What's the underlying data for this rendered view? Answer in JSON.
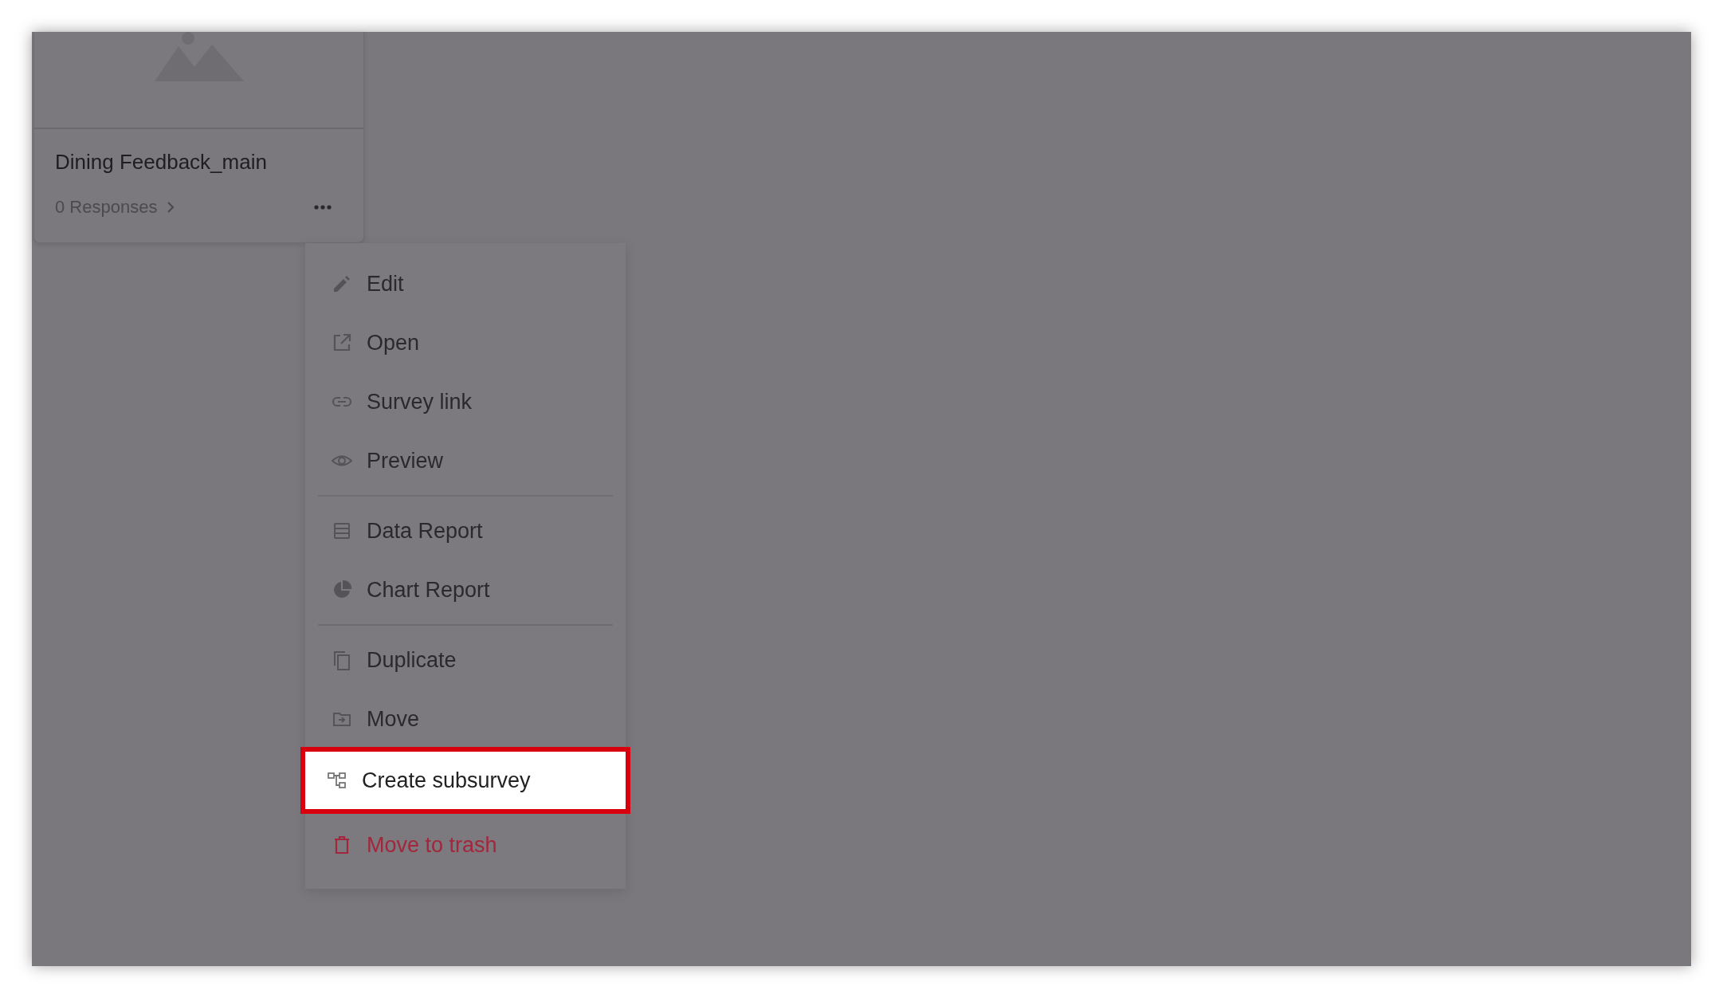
{
  "card": {
    "title": "Dining Feedback_main",
    "responses": "0 Responses"
  },
  "menu": {
    "groups": [
      [
        {
          "label": "Edit",
          "kind": "normal",
          "highlighted": false
        },
        {
          "label": "Open",
          "kind": "normal",
          "highlighted": false
        },
        {
          "label": "Survey link",
          "kind": "normal",
          "highlighted": false
        },
        {
          "label": "Preview",
          "kind": "normal",
          "highlighted": false
        }
      ],
      [
        {
          "label": "Data Report",
          "kind": "normal",
          "highlighted": false
        },
        {
          "label": "Chart Report",
          "kind": "normal",
          "highlighted": false
        }
      ],
      [
        {
          "label": "Duplicate",
          "kind": "normal",
          "highlighted": false
        },
        {
          "label": "Move",
          "kind": "normal",
          "highlighted": false
        },
        {
          "label": "Create subsurvey",
          "kind": "normal",
          "highlighted": true
        },
        {
          "label": "Move to trash",
          "kind": "danger",
          "highlighted": false
        }
      ]
    ]
  }
}
